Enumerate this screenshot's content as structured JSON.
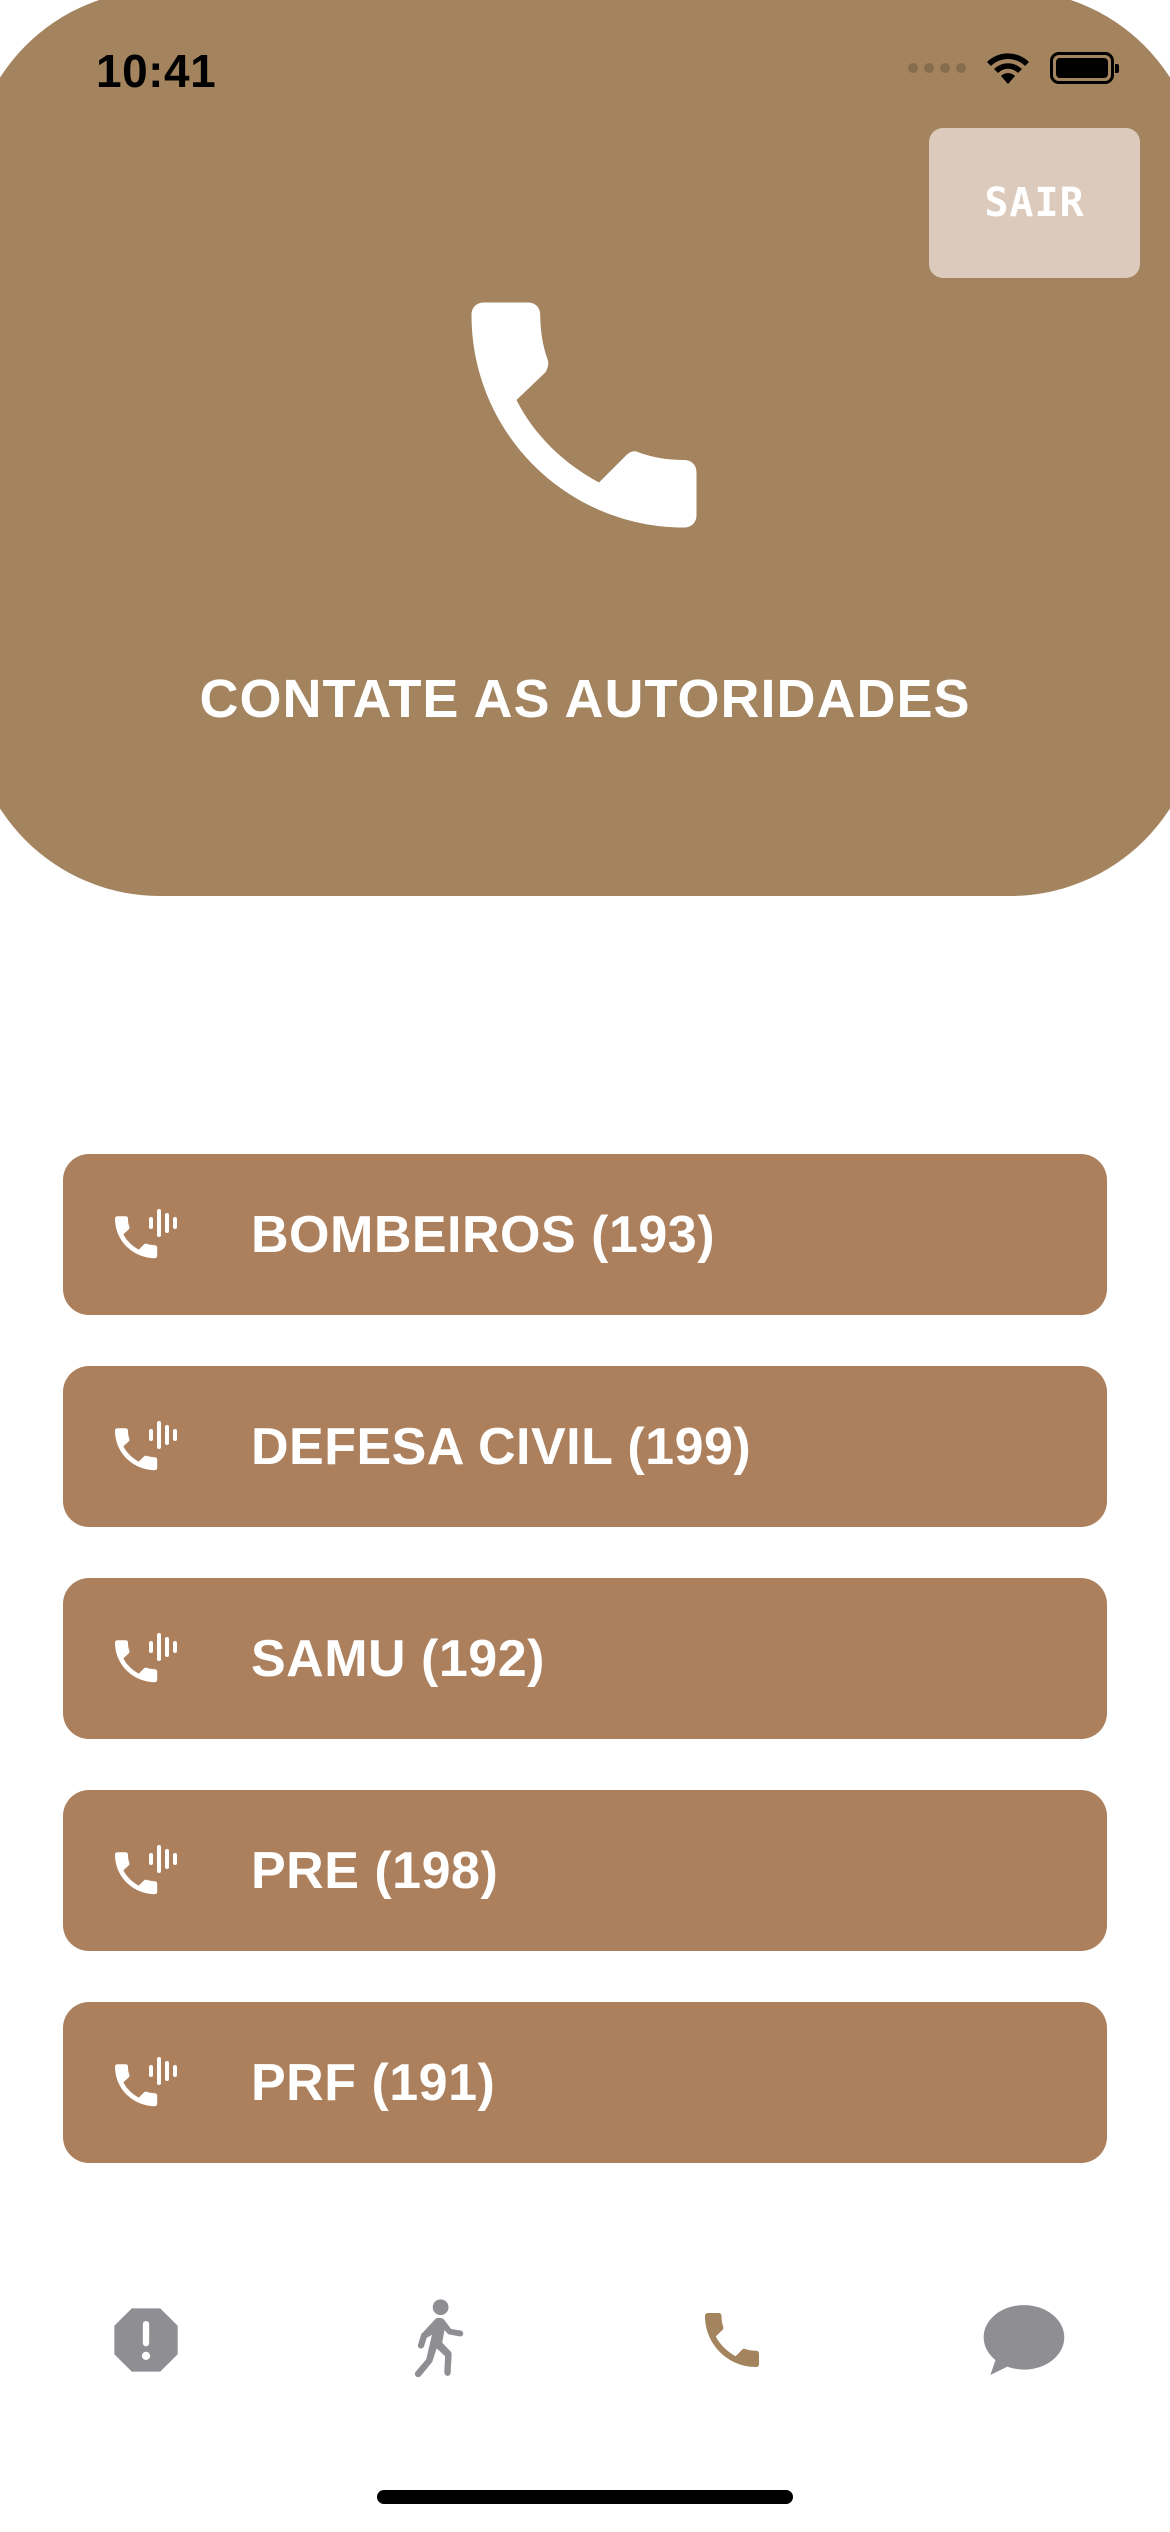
{
  "status_bar": {
    "time": "10:41"
  },
  "header": {
    "logout_label": "SAIR",
    "title": "CONTATE AS AUTORIDADES",
    "hero_icon": "phone-icon"
  },
  "contacts": [
    {
      "label": "BOMBEIROS (193)",
      "icon": "phone-calling-icon"
    },
    {
      "label": "DEFESA CIVIL (199)",
      "icon": "phone-calling-icon"
    },
    {
      "label": "SAMU (192)",
      "icon": "phone-calling-icon"
    },
    {
      "label": "PRE (198)",
      "icon": "phone-calling-icon"
    },
    {
      "label": "PRF (191)",
      "icon": "phone-calling-icon"
    }
  ],
  "tab_bar": {
    "tabs": [
      {
        "icon": "alert-octagon-icon",
        "active": false
      },
      {
        "icon": "walking-person-icon",
        "active": false
      },
      {
        "icon": "phone-icon",
        "active": true
      },
      {
        "icon": "chat-bubble-icon",
        "active": false
      }
    ]
  },
  "colors": {
    "header_bg": "#a3845e",
    "button_bg": "#ad805d",
    "logout_bg": "#dccbbd",
    "tab_active": "#a3845e",
    "tab_inactive": "#8e8e93"
  }
}
